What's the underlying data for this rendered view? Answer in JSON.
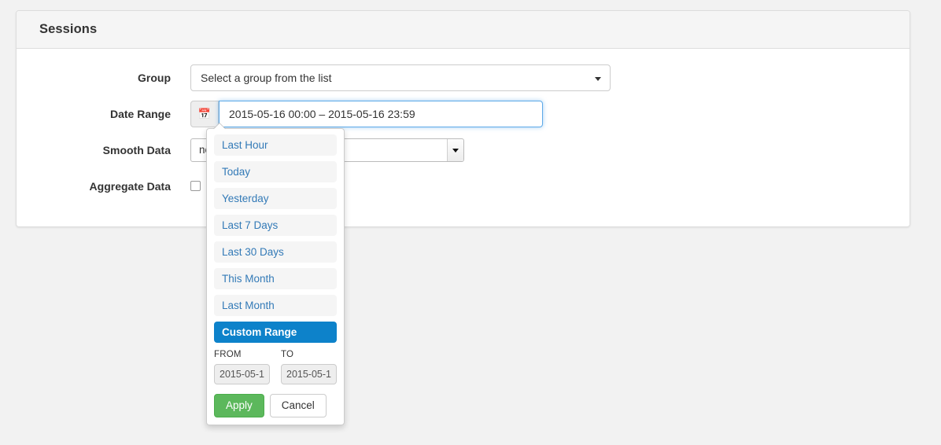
{
  "panel": {
    "title": "Sessions"
  },
  "form": {
    "group": {
      "label": "Group",
      "value": "Select a group from the list",
      "caret_icon": "caret-down-icon"
    },
    "date_range": {
      "label": "Date Range",
      "calendar_icon": "calendar-icon",
      "value": "2015-05-16 00:00 – 2015-05-16 23:59"
    },
    "smooth_data": {
      "label": "Smooth Data",
      "value": "no ",
      "caret_icon": "caret-down-icon"
    },
    "aggregate_data": {
      "label": "Aggregate Data",
      "checked": false
    }
  },
  "daterangepicker": {
    "ranges": [
      {
        "label": "Last Hour",
        "active": false
      },
      {
        "label": "Today",
        "active": false
      },
      {
        "label": "Yesterday",
        "active": false
      },
      {
        "label": "Last 7 Days",
        "active": false
      },
      {
        "label": "Last 30 Days",
        "active": false
      },
      {
        "label": "This Month",
        "active": false
      },
      {
        "label": "Last Month",
        "active": false
      },
      {
        "label": "Custom Range",
        "active": true
      }
    ],
    "from_label": "FROM",
    "to_label": "TO",
    "from_value": "2015-05-1",
    "to_value": "2015-05-1",
    "apply_label": "Apply",
    "cancel_label": "Cancel"
  },
  "colors": {
    "accent_blue": "#0d82ca",
    "link_blue": "#337ab7",
    "apply_green": "#5cb85c",
    "focus_border": "#5da9e8"
  }
}
